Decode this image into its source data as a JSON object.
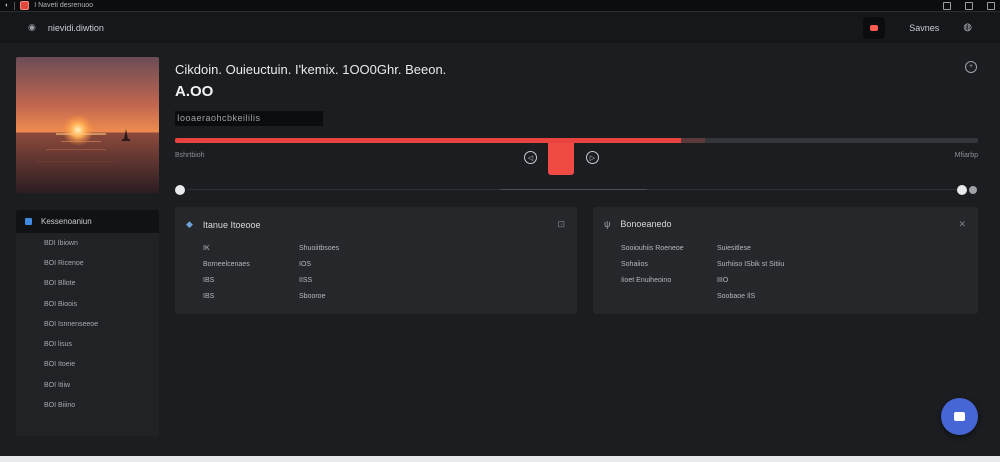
{
  "browser": {
    "tab_title": "I Naveti desrenuoo"
  },
  "header": {
    "brand": "nievidi.diwtion",
    "link": "Savnes"
  },
  "now_playing": {
    "title": "Cikdoin. Ouieuctuin. I'kemix. 1OO0Ghr. Beeon.",
    "time": "A.OO",
    "badge": "Iooaeraohcbkeililis",
    "time_elapsed": "Bshrtbioh",
    "time_total": "Mfiarbp",
    "progress_fraction": 0.63,
    "buffer_fraction": 0.66
  },
  "sidebar": {
    "header": "Kessenoaniun",
    "items": [
      "BDI Ibiown",
      "BOI Ricenoe",
      "BOI Bllote",
      "BOI Bioois",
      "BOI Isnnenseeoe",
      "BOI lisus",
      "BOI Itoeie",
      "BOI Itiiw",
      "BOI Biiino"
    ]
  },
  "card1": {
    "title": "Itanue Itoeooe",
    "rows": [
      {
        "k": "IK",
        "v": "Shuoiitbsoes"
      },
      {
        "k": "Borneelcenaes",
        "v": "IOS"
      },
      {
        "k": "IBS",
        "v": "IISS"
      },
      {
        "k": "IBS",
        "v": "Sbooroe"
      }
    ]
  },
  "card2": {
    "title": "Bonoeanedo",
    "rows": [
      {
        "k": "Sooiouhiis Roeneoe",
        "v": "Suiesitlese"
      },
      {
        "k": "Sohaiios",
        "v": "Surhiiso ISbik st Sitiiu"
      },
      {
        "k": "Iioet Enuiheoino",
        "v": "IIIO"
      },
      {
        "k": "",
        "v": "Soobaoe IlS"
      }
    ]
  },
  "colors": {
    "accent": "#e8433e",
    "fab": "#4666d6",
    "sidebar_marker": "#3e8be0"
  }
}
